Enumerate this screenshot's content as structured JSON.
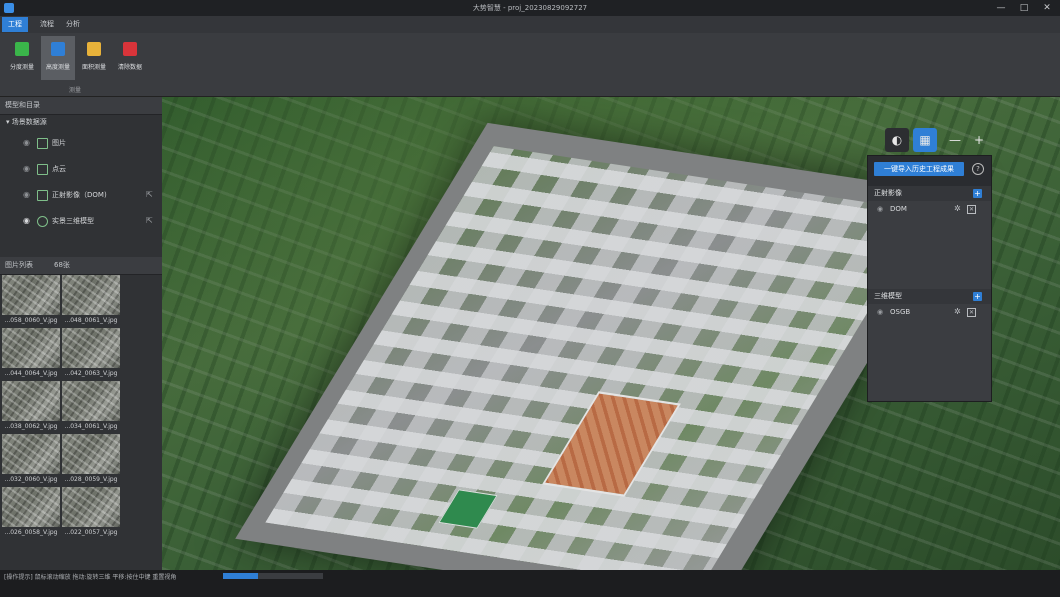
{
  "window": {
    "title": "大势智慧 - proj_20230829092727",
    "controls": [
      "—",
      "□",
      "✕"
    ]
  },
  "menu": {
    "tabs": [
      {
        "label": "工程",
        "active": true
      },
      {
        "label": "流程",
        "active": false
      },
      {
        "label": "分析",
        "active": false
      }
    ]
  },
  "ribbon": {
    "buttons": [
      {
        "label": "分度测量",
        "icon": "measure-icon",
        "color": "#3ab54a"
      },
      {
        "label": "高度测量",
        "icon": "height-icon",
        "color": "#2f7fd6",
        "active": true
      },
      {
        "label": "面积测量",
        "icon": "area-icon",
        "color": "#e8b23a"
      },
      {
        "label": "清除数据",
        "icon": "clear-icon",
        "color": "#d9343a"
      }
    ],
    "group_label": "测量"
  },
  "model_panel": {
    "title": "模型和目录",
    "root": "场景数据源",
    "items": [
      {
        "label": "图片",
        "has_ext": false
      },
      {
        "label": "点云",
        "has_ext": false
      },
      {
        "label": "正射影像（DOM)",
        "has_ext": true
      },
      {
        "label": "实景三维模型",
        "has_ext": true
      }
    ]
  },
  "image_list": {
    "title": "图片列表",
    "count": "68张",
    "thumbs": [
      "...058_0060_V.jpg",
      "...048_0061_V.jpg",
      "...044_0064_V.jpg",
      "...042_0063_V.jpg",
      "...038_0062_V.jpg",
      "...034_0061_V.jpg",
      "...032_0060_V.jpg",
      "...028_0059_V.jpg",
      "...026_0058_V.jpg",
      "...022_0057_V.jpg"
    ]
  },
  "viewport_tools": [
    {
      "icon": "globe-icon",
      "label": "◐",
      "active": false
    },
    {
      "icon": "layers-icon",
      "label": "▦",
      "active": true
    },
    {
      "icon": "zoom-out-icon",
      "label": "—",
      "active": false
    },
    {
      "icon": "zoom-in-icon",
      "label": "+",
      "active": false
    }
  ],
  "layer_panel": {
    "import_label": "一键导入历史工程成果",
    "help": "?",
    "sections": [
      {
        "title": "正射影像",
        "rows": [
          {
            "name": "DOM"
          }
        ]
      },
      {
        "title": "三维模型",
        "rows": [
          {
            "name": "OSGB"
          }
        ]
      }
    ]
  },
  "status": {
    "text": "[操作提示] 鼠标滚动缩放 拖动:旋转三维 平移:按住中键 重置视角",
    "progress": 0.35
  },
  "colors": {
    "accent": "#2f7fd6",
    "panel": "#303235",
    "titlebar": "#1f2124"
  }
}
